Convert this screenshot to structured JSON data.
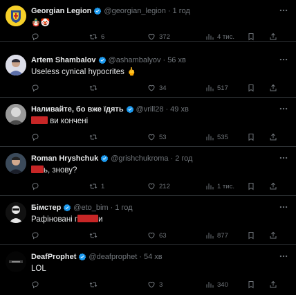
{
  "tweets": [
    {
      "name": "Georgian Legion",
      "handle": "@georgian_legion",
      "time": "1 год",
      "text": "",
      "emoji": "🪆🤡",
      "replies": "",
      "retweets": "6",
      "likes": "372",
      "views": "4 тис."
    },
    {
      "name": "Artem Shambalov",
      "handle": "@ashambalyov",
      "time": "56 хв",
      "text": "Useless cynical hypocrites 🖕",
      "replies": "",
      "retweets": "",
      "likes": "34",
      "views": "517"
    },
    {
      "name": "Наливайте, бо вже їдять",
      "handle": "@vrill28",
      "time": "49 хв",
      "text": " ви кончені",
      "replies": "",
      "retweets": "",
      "likes": "53",
      "views": "535"
    },
    {
      "name": "Roman Hryshchuk",
      "handle": "@grishchukroma",
      "time": "2 год",
      "text": "ь, знову?",
      "replies": "",
      "retweets": "1",
      "likes": "212",
      "views": "1 тис."
    },
    {
      "name": "Бімстер",
      "handle": "@eto_bim",
      "time": "1 год",
      "text_before": "Рафіновані г",
      "text_after": "и",
      "replies": "",
      "retweets": "",
      "likes": "63",
      "views": "877"
    },
    {
      "name": "DeafProphet",
      "handle": "@deafprophet",
      "time": "54 хв",
      "text": "LOL",
      "replies": "",
      "retweets": "",
      "likes": "3",
      "views": "340"
    }
  ],
  "colors": {
    "bg": "#000000",
    "text": "#e7e9ea",
    "muted": "#71767b",
    "verified": "#1d9bf0",
    "redact": "#c72626"
  }
}
